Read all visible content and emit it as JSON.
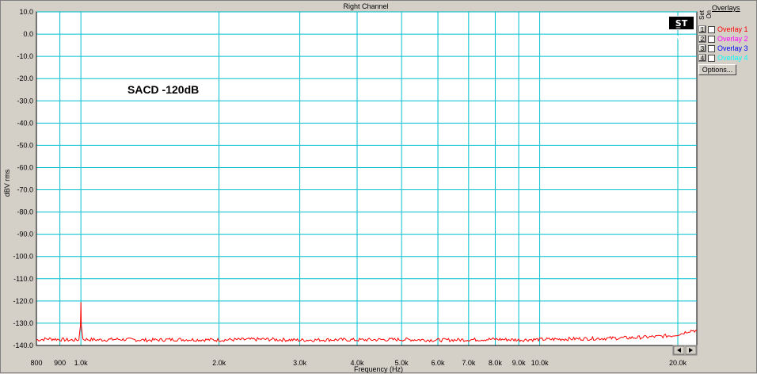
{
  "window": {
    "title": "Right Channel"
  },
  "annotation": {
    "text": "SACD -120dB"
  },
  "logo": {
    "glyphs": "S̲T ∿▽",
    "icon": "ap-logo-icon"
  },
  "overlays": {
    "header": "Overlays",
    "set_label": "Set",
    "on_label": "On",
    "items": [
      {
        "num": "1",
        "label": "Overlay 1",
        "color": "#ff0000"
      },
      {
        "num": "2",
        "label": "Overlay 2",
        "color": "#ff00ff"
      },
      {
        "num": "3",
        "label": "Overlay 3",
        "color": "#0000ff"
      },
      {
        "num": "4",
        "label": "Overlay 4",
        "color": "#00ffff"
      }
    ],
    "options_label": "Options..."
  },
  "colors": {
    "plot_bg": "#ffffff",
    "grid": "#00c0d0",
    "trace": "#ff0000",
    "window_bg": "#d4d0c8"
  },
  "chart_data": {
    "type": "line",
    "title": "Right Channel",
    "xlabel": "Frequency (Hz)",
    "ylabel": "dBV rms",
    "x_scale": "log",
    "xlim": [
      800,
      22000
    ],
    "ylim": [
      -140,
      10
    ],
    "grid": true,
    "x_ticks": [
      {
        "value": 800,
        "label": "800"
      },
      {
        "value": 900,
        "label": "900"
      },
      {
        "value": 1000,
        "label": "1.0k"
      },
      {
        "value": 2000,
        "label": "2.0k"
      },
      {
        "value": 3000,
        "label": "3.0k"
      },
      {
        "value": 4000,
        "label": "4.0k"
      },
      {
        "value": 5000,
        "label": "5.0k"
      },
      {
        "value": 6000,
        "label": "6.0k"
      },
      {
        "value": 7000,
        "label": "7.0k"
      },
      {
        "value": 8000,
        "label": "8.0k"
      },
      {
        "value": 9000,
        "label": "9.0k"
      },
      {
        "value": 10000,
        "label": "10.0k"
      },
      {
        "value": 20000,
        "label": "20.0k"
      }
    ],
    "y_ticks": [
      10,
      0,
      -10,
      -20,
      -30,
      -40,
      -50,
      -60,
      -70,
      -80,
      -90,
      -100,
      -110,
      -120,
      -130,
      -140
    ],
    "y_tick_labels": [
      "10.0",
      "0.0",
      "-10.0",
      "-20.0",
      "-30.0",
      "-40.0",
      "-50.0",
      "-60.0",
      "-70.0",
      "-80.0",
      "-90.0",
      "-100.0",
      "-110.0",
      "-120.0",
      "-130.0",
      "-140.0"
    ],
    "series": [
      {
        "color": "#ff0000",
        "points": [
          [
            800,
            -137.5
          ],
          [
            850,
            -137.0
          ],
          [
            900,
            -137.3
          ],
          [
            950,
            -137.6
          ],
          [
            990,
            -137.4
          ],
          [
            998,
            -131.0
          ],
          [
            1000,
            -120.5
          ],
          [
            1002,
            -131.0
          ],
          [
            1010,
            -137.2
          ],
          [
            1100,
            -137.5
          ],
          [
            1200,
            -137.2
          ],
          [
            1400,
            -137.6
          ],
          [
            1600,
            -137.3
          ],
          [
            2000,
            -137.5
          ],
          [
            2500,
            -137.2
          ],
          [
            3000,
            -137.6
          ],
          [
            3500,
            -137.4
          ],
          [
            4000,
            -137.5
          ],
          [
            5000,
            -137.3
          ],
          [
            6000,
            -137.6
          ],
          [
            7000,
            -137.4
          ],
          [
            8000,
            -137.2
          ],
          [
            9000,
            -137.5
          ],
          [
            10000,
            -137.3
          ],
          [
            12000,
            -137.0
          ],
          [
            14000,
            -136.8
          ],
          [
            16000,
            -136.5
          ],
          [
            18000,
            -136.0
          ],
          [
            19500,
            -135.5
          ],
          [
            20000,
            -135.0
          ],
          [
            20500,
            -134.5
          ],
          [
            21000,
            -133.6
          ],
          [
            21500,
            -133.2
          ],
          [
            22000,
            -133.4
          ]
        ]
      }
    ]
  }
}
